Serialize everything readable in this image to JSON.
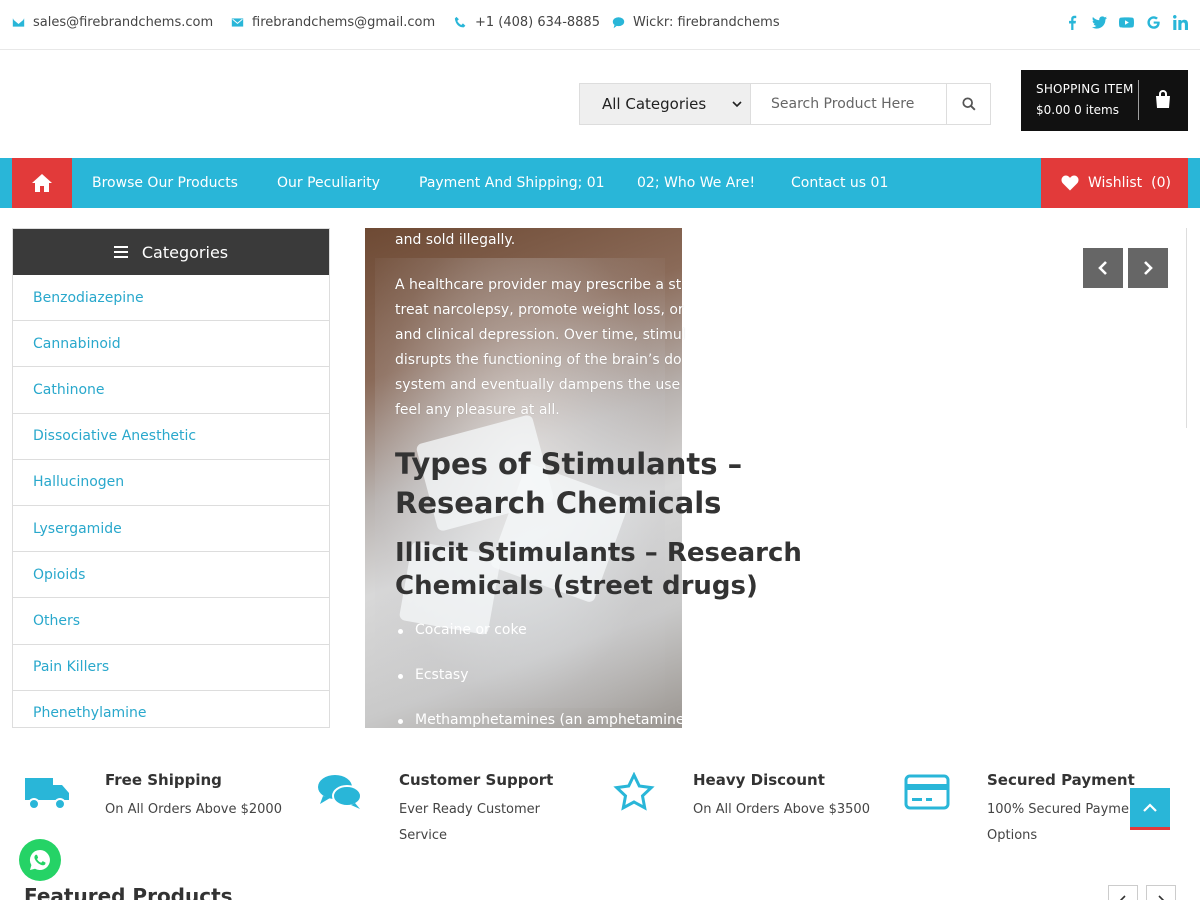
{
  "topbar": {
    "email_sales": "sales@firebrandchems.com",
    "email_gmail": "firebrandchems@gmail.com",
    "phone": "+1 (408) 634-8885",
    "wickr": "Wickr: firebrandchems",
    "socials": [
      "facebook-icon",
      "twitter-icon",
      "youtube-icon",
      "google-icon",
      "linkedin-icon"
    ]
  },
  "search": {
    "category_selected": "All Categories",
    "placeholder": "Search Product Here"
  },
  "cart": {
    "title": "SHOPPING ITEM",
    "amount": "$0.00 0 items"
  },
  "nav": {
    "items": [
      "Browse Our Products",
      "Our Peculiarity",
      "Payment And Shipping; 01",
      "02; Who We Are!",
      "Contact us 01"
    ],
    "wishlist_label": "Wishlist",
    "wishlist_count": "(0)"
  },
  "categories": {
    "heading": "Categories",
    "items": [
      "Benzodiazepine",
      "Cannabinoid",
      "Cathinone",
      "Dissociative Anesthetic",
      "Hallucinogen",
      "Lysergamide",
      "Opioids",
      "Others",
      "Pain Killers",
      "Phenethylamine"
    ]
  },
  "content": {
    "lines": [
      "and sold illegally.",
      "A healthcare provider may prescribe a st",
      "treat narcolepsy, promote weight loss, or",
      "and clinical depression. Over time, stimul",
      "disrupts the functioning of the brain’s do",
      "system and eventually dampens the use",
      "feel any pleasure at all."
    ],
    "heading_h2": "Types of Stimulants – Research Chemicals",
    "heading_h3": "Illicit Stimulants – Research Chemicals (street drugs)",
    "bullets": [
      "Cocaine or coke",
      "Ecstasy",
      "Methamphetamines (an amphetamine"
    ]
  },
  "features": [
    {
      "icon": "truck-icon",
      "title": "Free Shipping",
      "desc": "On All Orders Above $2000"
    },
    {
      "icon": "chat-icon",
      "title": "Customer Support",
      "desc": "Ever Ready Customer Service"
    },
    {
      "icon": "star-icon",
      "title": "Heavy Discount",
      "desc": "On All Orders Above $3500"
    },
    {
      "icon": "credit-card-icon",
      "title": "Secured Payment",
      "desc": "100% Secured Payment Options"
    }
  ],
  "featured": {
    "title": "Featured Products"
  },
  "colors": {
    "accent": "#29b6d8",
    "red": "#e23a3a",
    "dark": "#111111"
  }
}
